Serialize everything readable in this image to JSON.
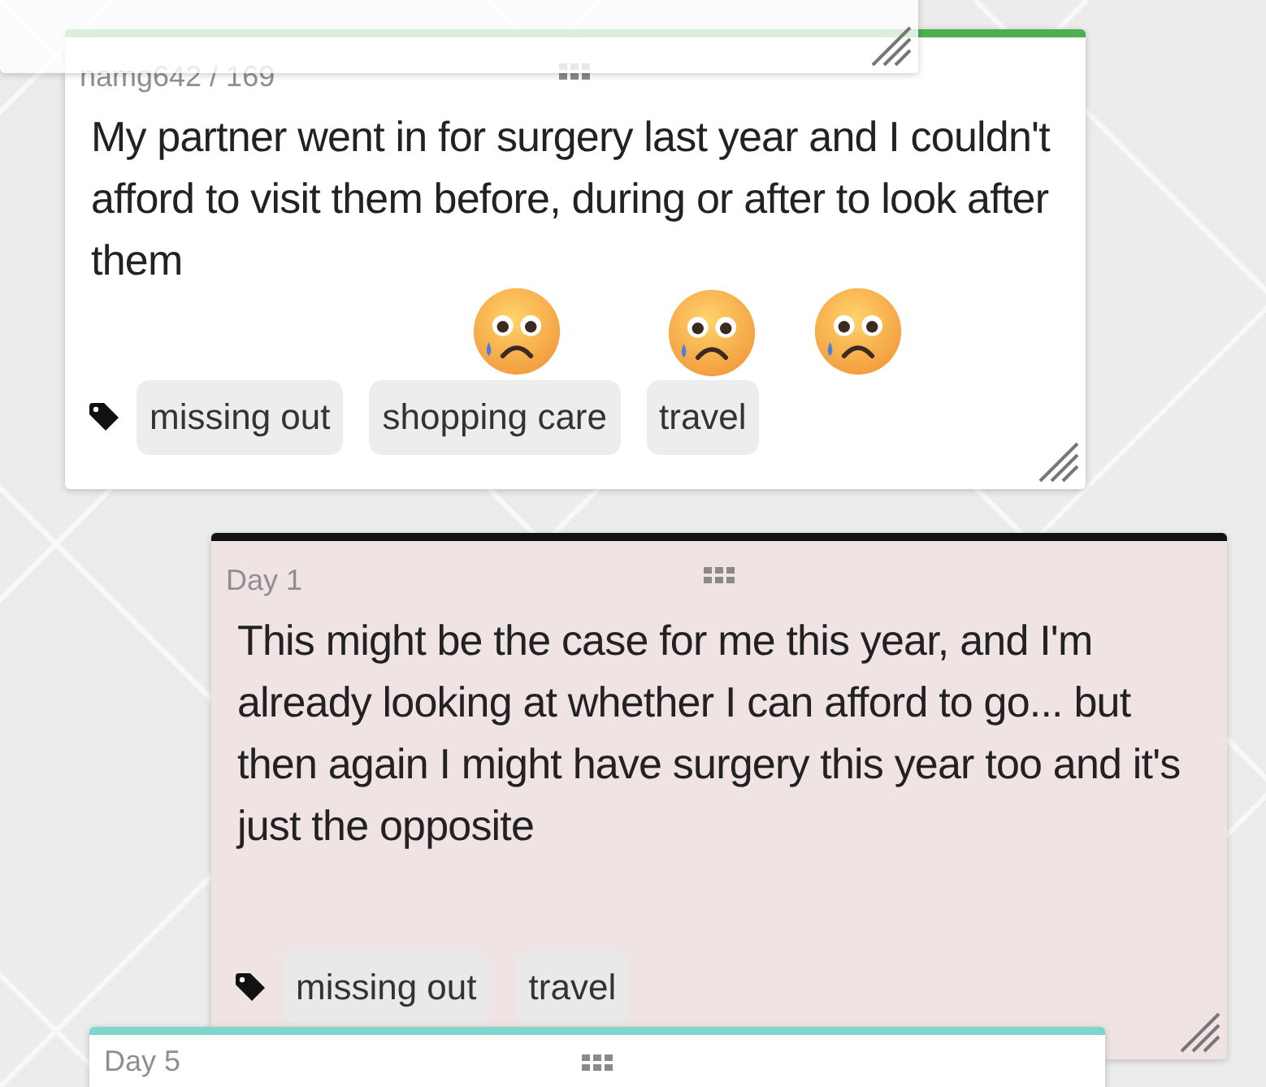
{
  "cards": [
    {
      "kind": "plain",
      "color": "#4caf50",
      "header": "namg642 / 169",
      "text": "My partner went in for surgery last year and I couldn't afford to visit them before, during or after to look after them",
      "tags": [
        "missing out",
        "shopping care",
        "travel"
      ]
    },
    {
      "kind": "faded",
      "color": "#ffffff"
    },
    {
      "kind": "tinted",
      "color": "#111111",
      "header": "Day 1",
      "text": "This might be the case for me this year, and I'm already looking at whether I can afford to go... but then again I might have surgery this year too and it's just the opposite",
      "tags": [
        "missing out",
        "travel"
      ]
    },
    {
      "kind": "plain",
      "color": "#7fd6cf",
      "header": "Day 5"
    }
  ],
  "reactions": [
    {
      "kind": "sad-tear"
    },
    {
      "kind": "sad-tear"
    },
    {
      "kind": "sad-tear"
    }
  ]
}
